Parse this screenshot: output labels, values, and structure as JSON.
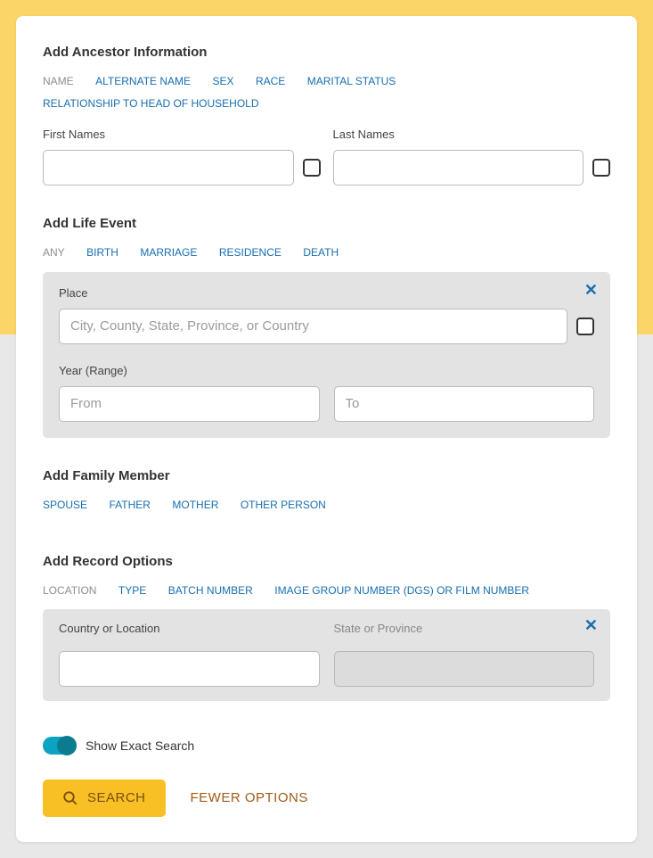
{
  "ancestor": {
    "title": "Add Ancestor Information",
    "tabs": [
      "NAME",
      "ALTERNATE NAME",
      "SEX",
      "RACE",
      "MARITAL STATUS",
      "RELATIONSHIP TO HEAD OF HOUSEHOLD"
    ],
    "first_names_label": "First Names",
    "last_names_label": "Last Names"
  },
  "life_event": {
    "title": "Add Life Event",
    "tabs": [
      "ANY",
      "BIRTH",
      "MARRIAGE",
      "RESIDENCE",
      "DEATH"
    ],
    "place_label": "Place",
    "place_placeholder": "City, County, State, Province, or Country",
    "year_label": "Year (Range)",
    "from_placeholder": "From",
    "to_placeholder": "To"
  },
  "family": {
    "title": "Add Family Member",
    "tabs": [
      "SPOUSE",
      "FATHER",
      "MOTHER",
      "OTHER PERSON"
    ]
  },
  "record": {
    "title": "Add Record Options",
    "tabs": [
      "LOCATION",
      "TYPE",
      "BATCH NUMBER",
      "IMAGE GROUP NUMBER (DGS) OR FILM NUMBER"
    ],
    "country_label": "Country or Location",
    "state_label": "State or Province"
  },
  "toggle_label": "Show Exact Search",
  "search_label": "SEARCH",
  "fewer_label": "FEWER OPTIONS"
}
